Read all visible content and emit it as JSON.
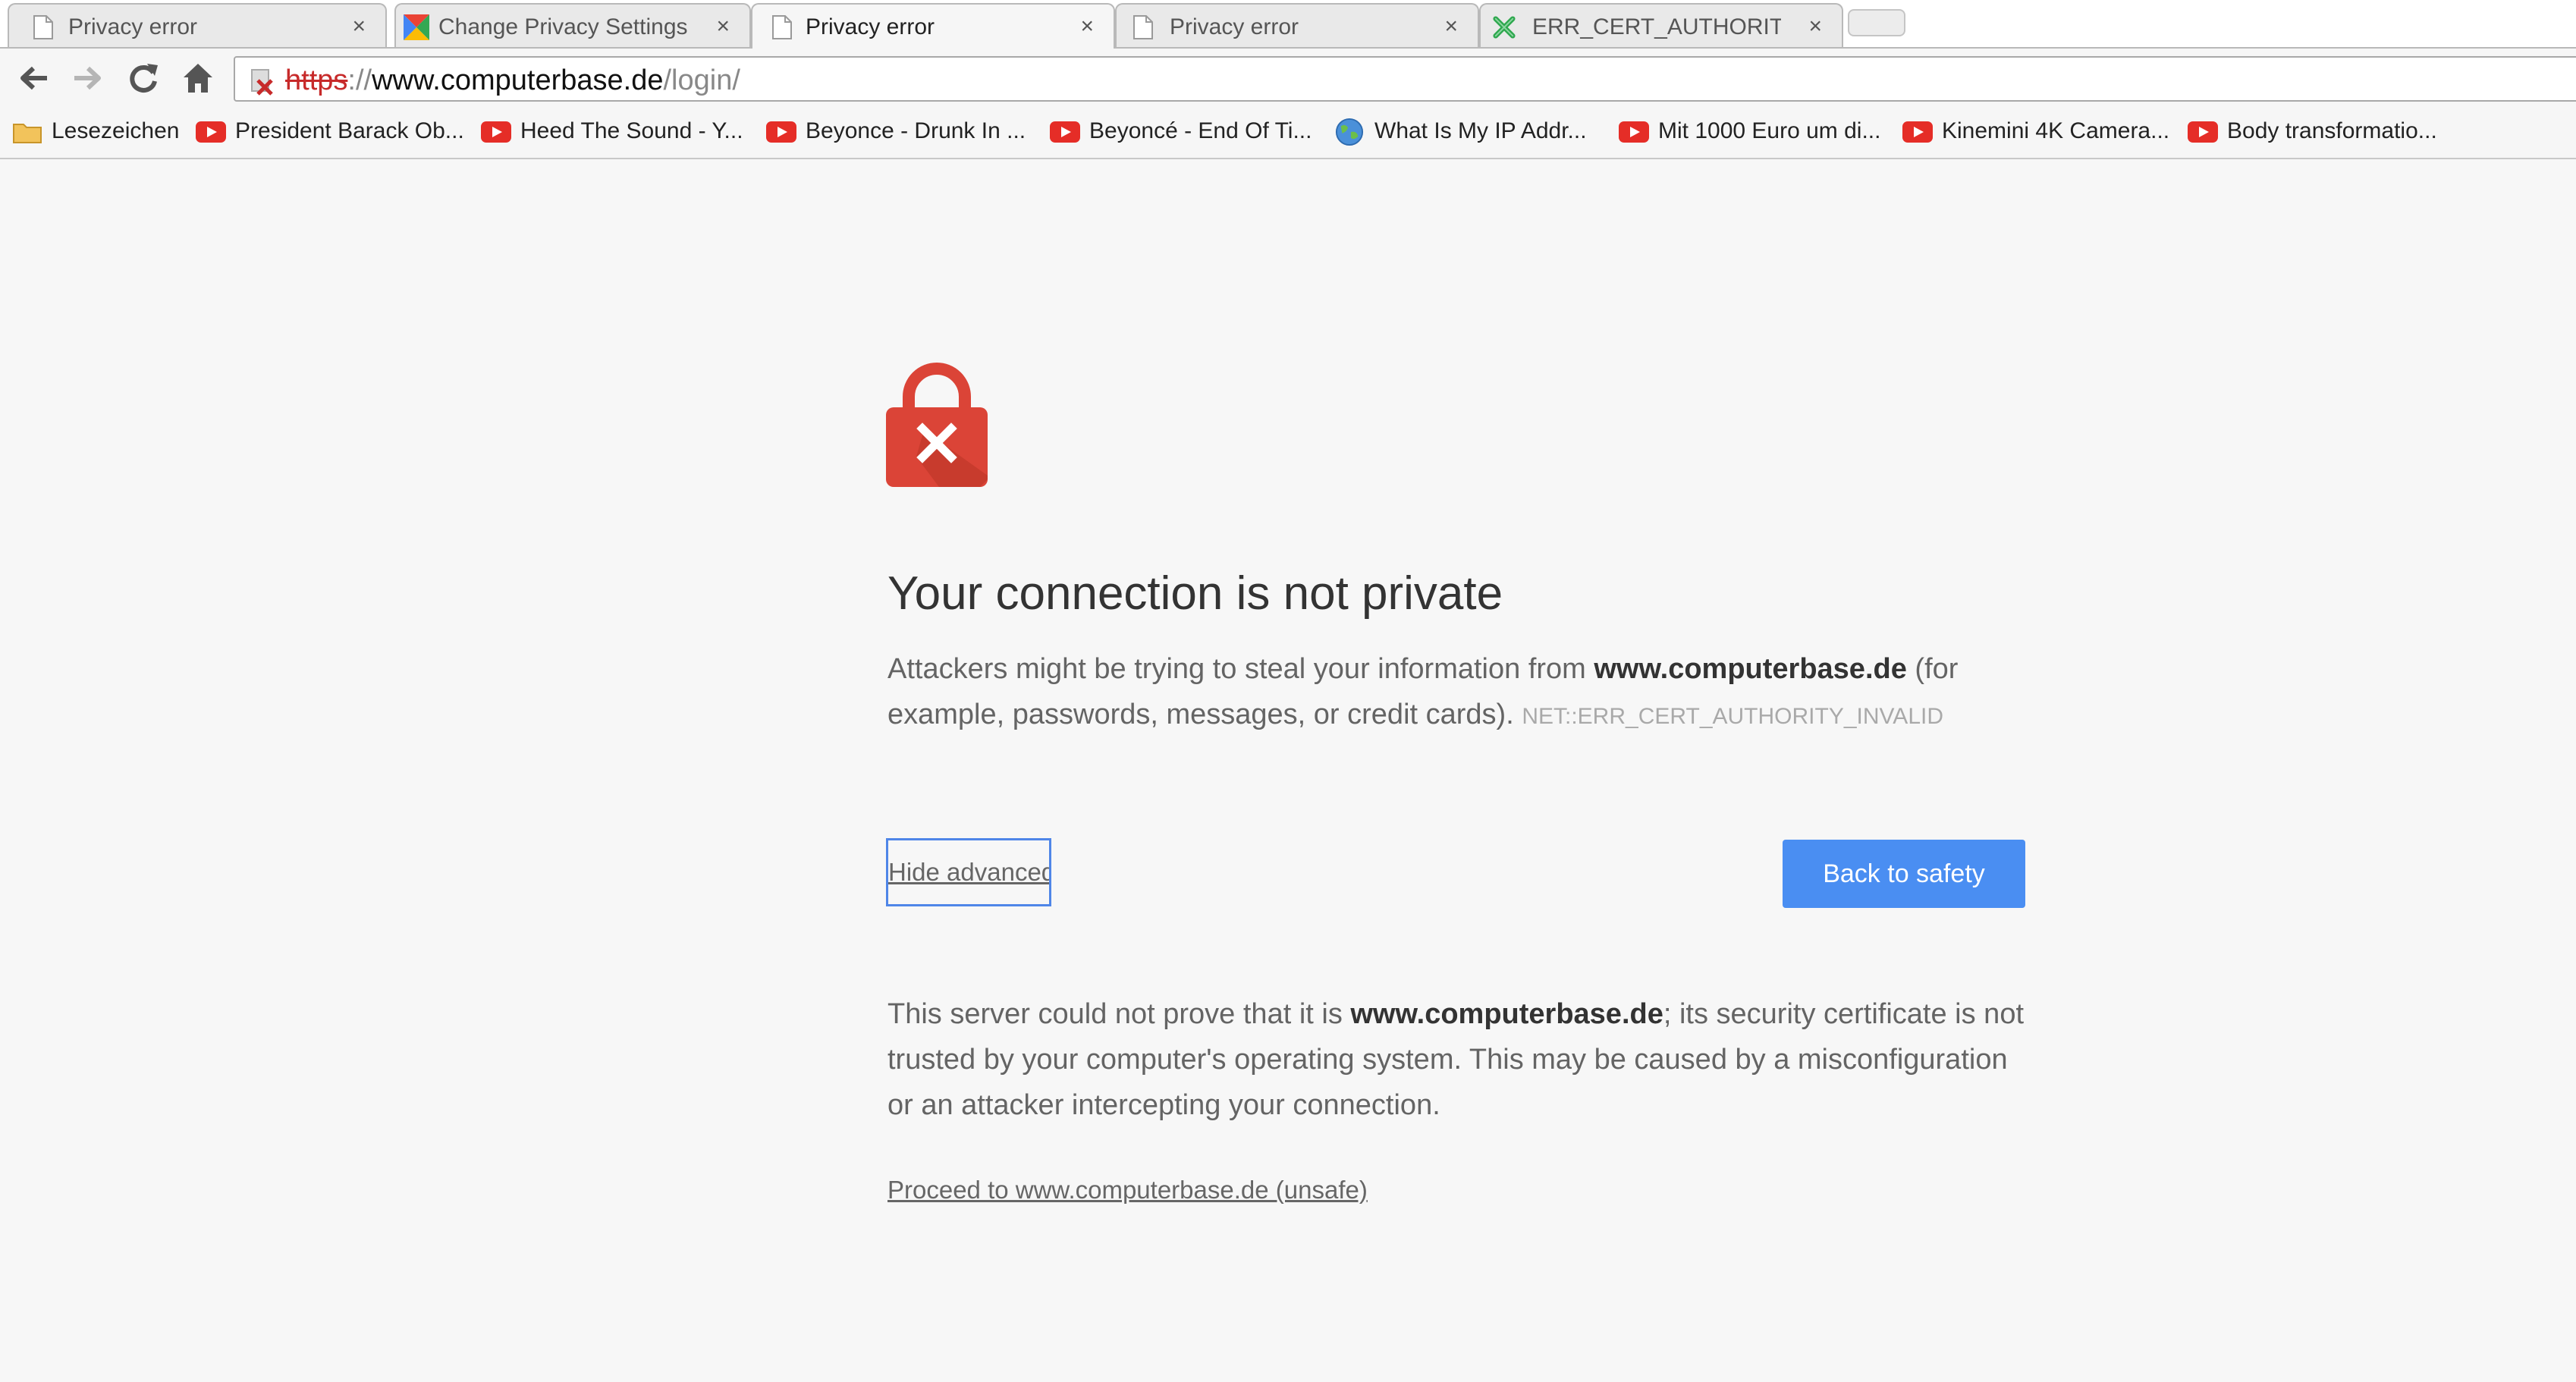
{
  "tabs": [
    {
      "title": "Privacy error",
      "close": "×",
      "icon": "page-icon",
      "active": false
    },
    {
      "title": "Change Privacy Settings a",
      "close": "×",
      "icon": "google-icon",
      "active": false
    },
    {
      "title": "Privacy error",
      "close": "×",
      "icon": "page-icon",
      "active": true
    },
    {
      "title": "Privacy error",
      "close": "×",
      "icon": "page-icon",
      "active": false
    },
    {
      "title": "ERR_CERT_AUTHORITY_IN",
      "close": "×",
      "icon": "green-x-icon",
      "active": false
    }
  ],
  "toolbar": {
    "back": "back-arrow-icon",
    "forward": "forward-arrow-icon",
    "reload": "reload-icon",
    "home": "home-icon"
  },
  "omnibox": {
    "scheme": "https",
    "separator": "://",
    "host": "www.computerbase.de",
    "path": "/login/",
    "security_icon": "broken-lock-icon"
  },
  "bookmarks": [
    {
      "label": "Lesezeichen",
      "icon": "folder-icon"
    },
    {
      "label": "President Barack Ob...",
      "icon": "youtube-icon"
    },
    {
      "label": "Heed The Sound - Y...",
      "icon": "youtube-icon"
    },
    {
      "label": "Beyonce - Drunk In ...",
      "icon": "youtube-icon"
    },
    {
      "label": "Beyoncé - End Of Ti...",
      "icon": "youtube-icon"
    },
    {
      "label": "What Is My IP Addr...",
      "icon": "globe-icon"
    },
    {
      "label": "Mit 1000 Euro um di...",
      "icon": "youtube-icon"
    },
    {
      "label": "Kinemini 4K Camera...",
      "icon": "youtube-icon"
    },
    {
      "label": "Body transformatio...",
      "icon": "youtube-icon"
    }
  ],
  "page": {
    "heading": "Your connection is not private",
    "desc_pre": "Attackers might be trying to steal your information from ",
    "desc_host": "www.computerbase.de",
    "desc_post": " (for example, passwords, messages, or credit cards). ",
    "error_code": "NET::ERR_CERT_AUTHORITY_INVALID",
    "hide_advanced": "Hide advanced",
    "back_to_safety": "Back to safety",
    "details_pre": "This server could not prove that it is ",
    "details_host": "www.computerbase.de",
    "details_post": "; its security certificate is not trusted by your computer's operating system. This may be caused by a misconfiguration or an attacker intercepting your connection.",
    "proceed_link": "Proceed to www.computerbase.de (unsafe)"
  },
  "colors": {
    "error_red": "#db4437",
    "button_blue": "#4a8ef2",
    "focus_blue": "#4f86e8",
    "youtube_red": "#e52d27"
  }
}
